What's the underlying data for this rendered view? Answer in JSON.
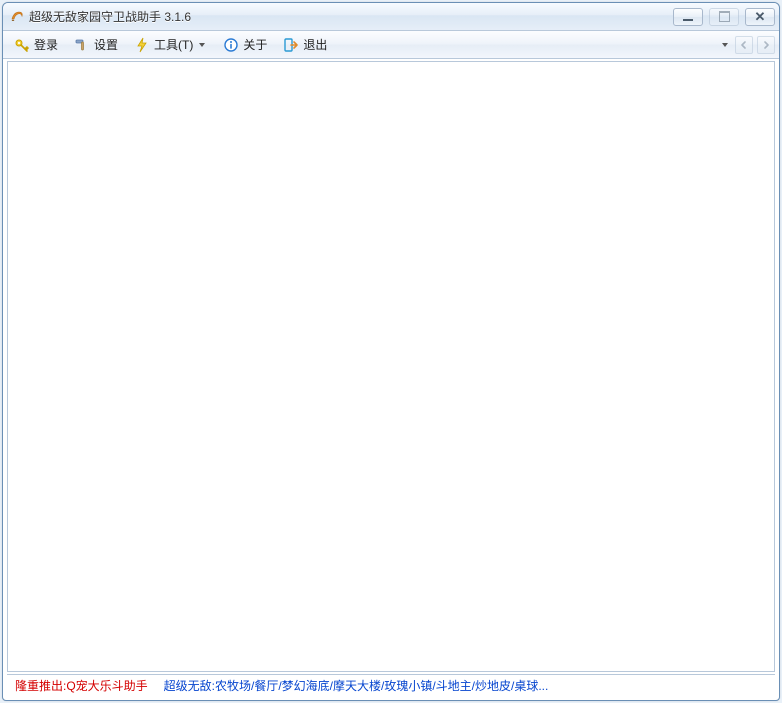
{
  "window": {
    "title": "超级无敌家园守卫战助手 3.1.6"
  },
  "toolbar": {
    "login": "登录",
    "settings": "设置",
    "tools": "工具(T)",
    "about": "关于",
    "exit": "退出"
  },
  "status": {
    "promo": "隆重推出:Q宠大乐斗助手",
    "links": "超级无敌:农牧场/餐厅/梦幻海底/摩天大楼/玫瑰小镇/斗地主/炒地皮/桌球..."
  }
}
